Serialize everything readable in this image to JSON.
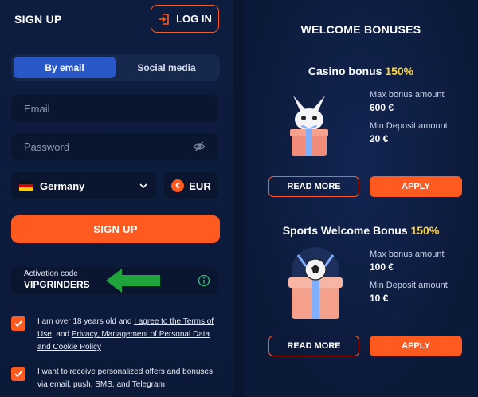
{
  "signup": {
    "title": "SIGN UP",
    "login_label": "LOG IN",
    "tabs": [
      {
        "label": "By email",
        "active": true
      },
      {
        "label": "Social media",
        "active": false
      }
    ],
    "email_placeholder": "Email",
    "password_placeholder": "Password",
    "country": "Germany",
    "currency": "EUR",
    "submit_label": "SIGN UP",
    "activation_label": "Activation code",
    "activation_code": "VIPGRINDERS",
    "consent_1_prefix": "I am over 18 years old and ",
    "consent_1_link1": "I agree to the Terms of Use",
    "consent_1_mid": ", and ",
    "consent_1_link2": "Privacy, Management of Personal Data and Cookie Policy",
    "consent_2": "I want to receive personalized offers and bonuses via email, push, SMS, and Telegram"
  },
  "bonuses": {
    "title": "WELCOME BONUSES",
    "casino": {
      "name": "Casino bonus",
      "percent": "150%",
      "max_label": "Max bonus amount",
      "max_value": "600 €",
      "min_label": "Min Deposit amount",
      "min_value": "20 €",
      "read_more": "READ MORE",
      "apply": "APPLY"
    },
    "sports": {
      "name": "Sports Welcome Bonus",
      "percent": "150%",
      "max_label": "Max bonus amount",
      "max_value": "100 €",
      "min_label": "Min Deposit amount",
      "min_value": "10 €",
      "read_more": "READ MORE",
      "apply": "APPLY"
    }
  },
  "colors": {
    "accent": "#ff5a1f",
    "tab_active": "#2b58c8",
    "highlight": "#ffd43b",
    "arrow": "#1fa33a",
    "background": "#0c1a3a"
  },
  "icons": [
    "login-icon",
    "eye-off-icon",
    "germany-flag-icon",
    "chevron-down-icon",
    "euro-icon",
    "info-icon",
    "green-arrow-icon",
    "check-icon"
  ]
}
